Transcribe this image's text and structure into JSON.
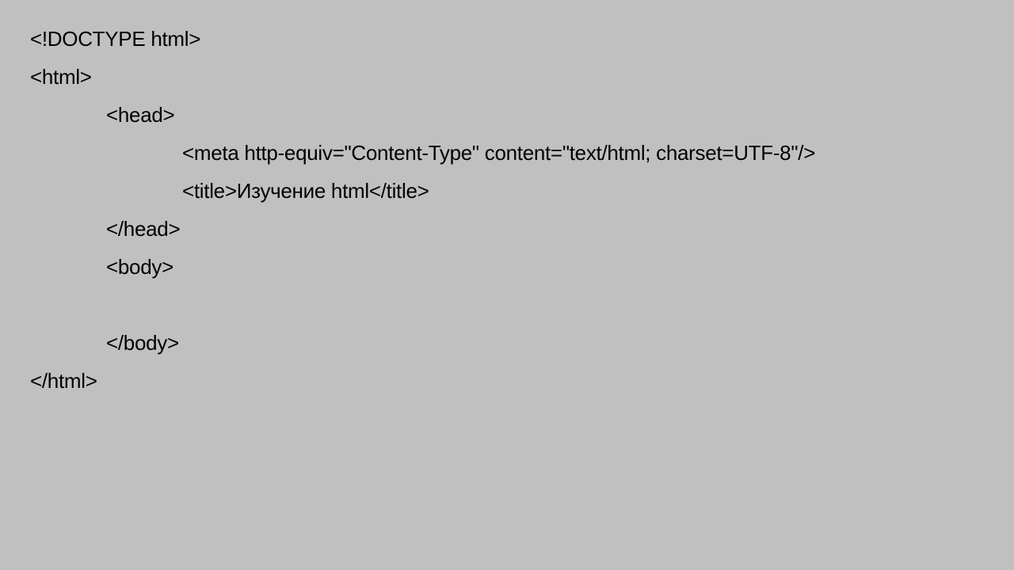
{
  "slide": {
    "lines": [
      {
        "text": "<!DOCTYPE html>",
        "indent": 0
      },
      {
        "text": "<html>",
        "indent": 0
      },
      {
        "text": "<head>",
        "indent": 1
      },
      {
        "text": "<meta http-equiv=\"Content-Type\" content=\"text/html; charset=UTF-8\"/>",
        "indent": 2
      },
      {
        "text": "<title>Изучение html</title>",
        "indent": 2
      },
      {
        "text": "</head>",
        "indent": 1
      },
      {
        "text": "<body>",
        "indent": 1
      },
      {
        "text": "",
        "indent": 1
      },
      {
        "text": "</body>",
        "indent": 1
      },
      {
        "text": "</html>",
        "indent": 0
      }
    ]
  }
}
